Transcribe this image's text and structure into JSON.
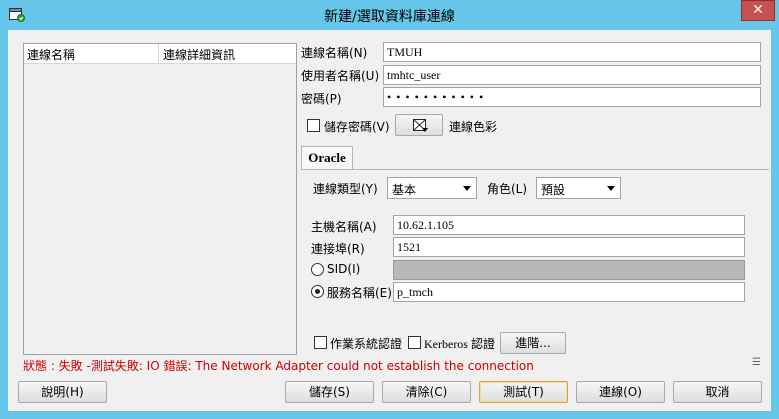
{
  "window": {
    "title": "新建/選取資料庫連線",
    "close_glyph": "✕"
  },
  "connection_list": {
    "col_name": "連線名稱",
    "col_details": "連線詳細資訊"
  },
  "form": {
    "conn_name_label": "連線名稱(N)",
    "conn_name_value": "TMUH",
    "user_label": "使用者名稱(U)",
    "user_value": "tmhtc_user",
    "password_label": "密碼(P)",
    "password_value": "• • • • • • • • • • •",
    "save_password_label": "儲存密碼(V)",
    "save_password_checked": false,
    "conn_color_label": "連線色彩"
  },
  "tabs": [
    "Oracle"
  ],
  "oracle": {
    "conn_type_label": "連線類型(Y)",
    "conn_type_value": "基本",
    "role_label": "角色(L)",
    "role_value": "預設",
    "host_label": "主機名稱(A)",
    "host_value": "10.62.1.105",
    "port_label": "連接埠(R)",
    "port_value": "1521",
    "sid_label": "SID(I)",
    "sid_value": "",
    "service_label": "服務名稱(E)",
    "service_value": "p_tmch",
    "selected_option": "service",
    "os_auth_label": "作業系統認證",
    "kerberos_label": "Kerberos 認證",
    "advanced_label": "進階..."
  },
  "status": {
    "text": "狀態 : 失敗 -測試失敗: IO 錯誤: The Network Adapter could not establish the connection",
    "color": "#cc0000"
  },
  "buttons": {
    "help": "說明(H)",
    "save": "儲存(S)",
    "clear": "清除(C)",
    "test": "測試(T)",
    "connect": "連線(O)",
    "cancel": "取消"
  }
}
